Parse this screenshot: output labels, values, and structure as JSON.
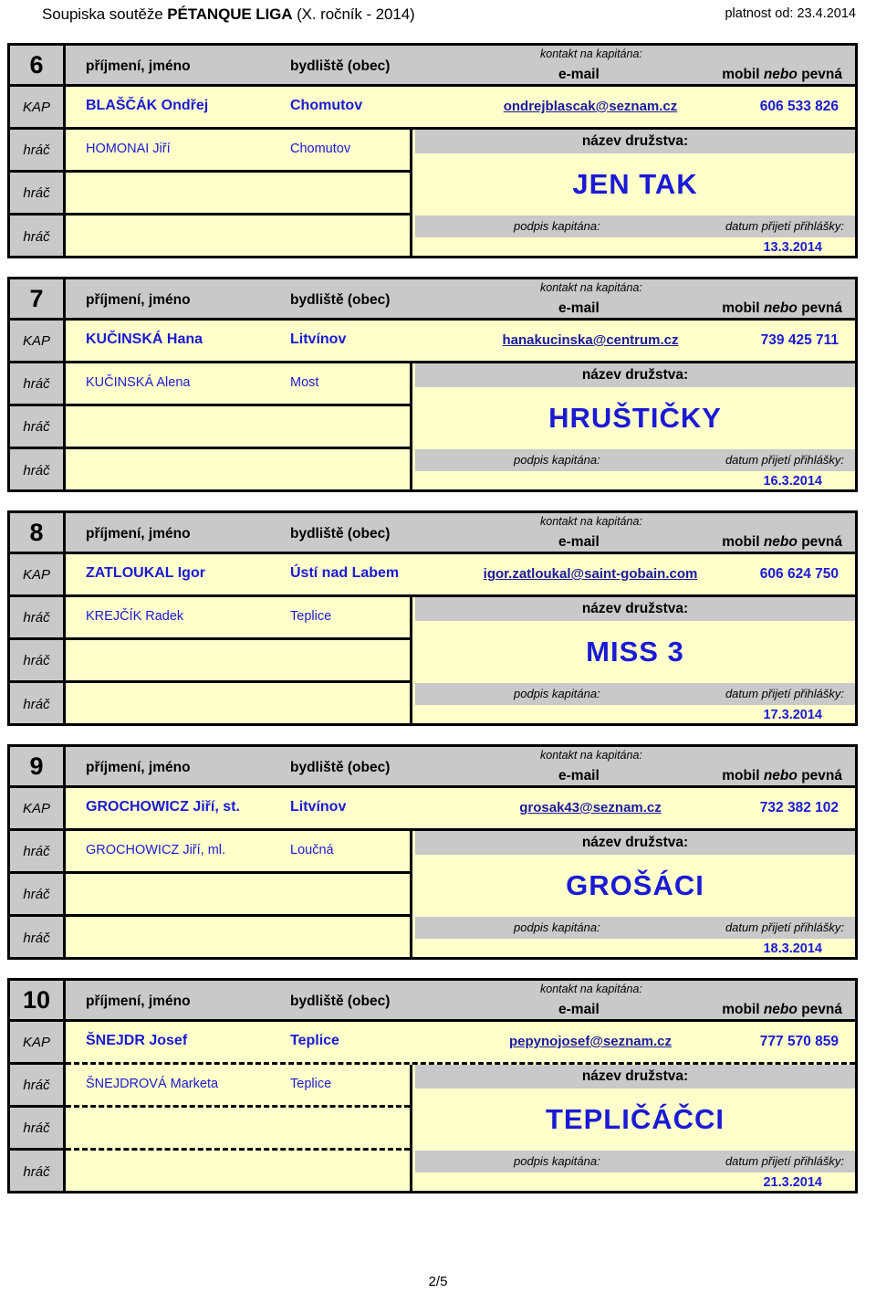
{
  "header": {
    "title_prefix": "Soupiska soutěže ",
    "title_bold": "PÉTANQUE LIGA",
    "title_suffix": " (X. ročník - 2014)",
    "validity": "platnost od: 23.4.2014"
  },
  "column_headers": {
    "name": "příjmení, jméno",
    "town": "bydliště (obec)",
    "contact": "kontakt na kapitána:",
    "email": "e-mail",
    "phone_mobil": "mobil",
    "phone_nebo": "nebo",
    "phone_pevna": "pevná"
  },
  "row_labels": {
    "captain": "KAP",
    "player": "hráč"
  },
  "panel_labels": {
    "team_name": "název družstva:",
    "signature": "podpis kapitána:",
    "date_received": "datum přijetí přihlášky:"
  },
  "colors": {
    "header_gray": "#c9c9c9",
    "row_yellow": "#ffffcc",
    "text_blue": "#1a1ad6",
    "link_blue": "#1a1a9e",
    "border_black": "#000000"
  },
  "blocks": [
    {
      "number": "6",
      "captain": {
        "name": "BLAŠČÁK Ondřej",
        "town": "Chomutov",
        "email": "ondrejblascak@seznam.cz",
        "phone": "606 533 826"
      },
      "players": [
        {
          "name": "HOMONAI Jiří",
          "town": "Chomutov"
        },
        {
          "name": "",
          "town": ""
        },
        {
          "name": "",
          "town": ""
        }
      ],
      "team_name": "JEN TAK",
      "date": "13.3.2014",
      "dashed": false
    },
    {
      "number": "7",
      "captain": {
        "name": "KUČINSKÁ Hana",
        "town": "Litvínov",
        "email": "hanakucinska@centrum.cz",
        "phone": "739 425 711"
      },
      "players": [
        {
          "name": "KUČINSKÁ Alena",
          "town": "Most"
        },
        {
          "name": "",
          "town": ""
        },
        {
          "name": "",
          "town": ""
        }
      ],
      "team_name": "HRUŠTIČKY",
      "date": "16.3.2014",
      "dashed": false
    },
    {
      "number": "8",
      "captain": {
        "name": "ZATLOUKAL Igor",
        "town": "Ústí nad Labem",
        "email": "igor.zatloukal@saint-gobain.com",
        "phone": "606 624 750"
      },
      "players": [
        {
          "name": "KREJČÍK Radek",
          "town": "Teplice"
        },
        {
          "name": "",
          "town": ""
        },
        {
          "name": "",
          "town": ""
        }
      ],
      "team_name": "MISS 3",
      "date": "17.3.2014",
      "dashed": false
    },
    {
      "number": "9",
      "captain": {
        "name": "GROCHOWICZ Jiří, st.",
        "town": "Litvínov",
        "email": "grosak43@seznam.cz",
        "phone": "732 382 102"
      },
      "players": [
        {
          "name": "GROCHOWICZ Jiří, ml.",
          "town": "Loučná"
        },
        {
          "name": "",
          "town": ""
        },
        {
          "name": "",
          "town": ""
        }
      ],
      "team_name": "GROŠÁCI",
      "date": "18.3.2014",
      "dashed": false
    },
    {
      "number": "10",
      "captain": {
        "name": "ŠNEJDR Josef",
        "town": "Teplice",
        "email": "pepynojosef@seznam.cz",
        "phone": "777 570 859"
      },
      "players": [
        {
          "name": "ŠNEJDROVÁ Marketa",
          "town": "Teplice"
        },
        {
          "name": "",
          "town": ""
        },
        {
          "name": "",
          "town": ""
        }
      ],
      "team_name": "TEPLIČÁČCI",
      "date": "21.3.2014",
      "dashed": true
    }
  ],
  "footer": {
    "page": "2/5"
  }
}
